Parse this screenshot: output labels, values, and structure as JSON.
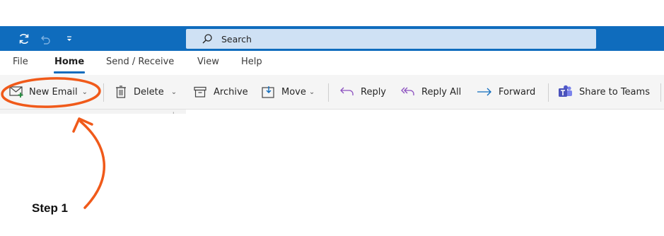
{
  "titlebar": {
    "search_label": "Search",
    "accent": "#0f6cbd"
  },
  "tabs": [
    {
      "label": "File"
    },
    {
      "label": "Home",
      "active": true
    },
    {
      "label": "Send / Receive"
    },
    {
      "label": "View"
    },
    {
      "label": "Help"
    }
  ],
  "ribbon": {
    "new_email": "New Email",
    "delete": "Delete",
    "archive": "Archive",
    "move": "Move",
    "reply": "Reply",
    "reply_all": "Reply All",
    "forward": "Forward",
    "share_to_teams": "Share to Teams"
  },
  "annotation": {
    "step_label": "Step 1",
    "color": "#f05a1a"
  }
}
